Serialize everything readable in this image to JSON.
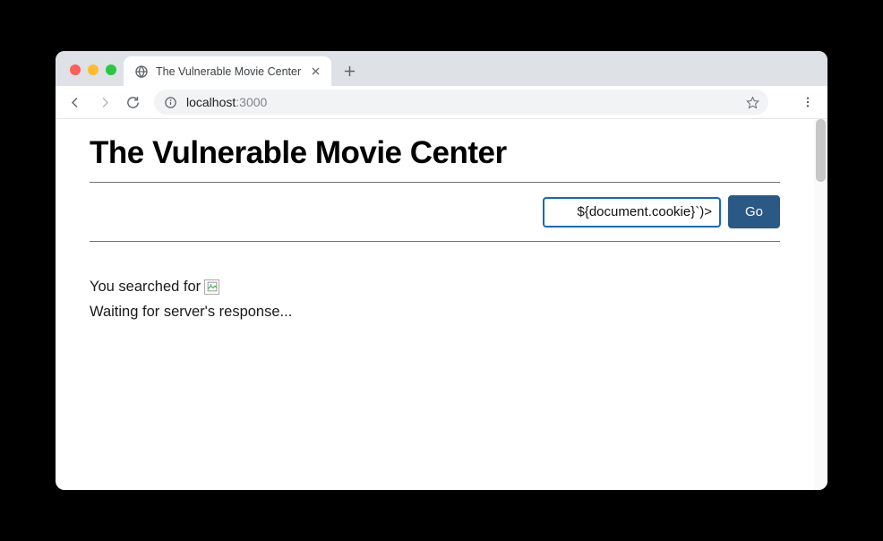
{
  "browser": {
    "tab_title": "The Vulnerable Movie Center",
    "url_host": "localhost",
    "url_port": ":3000"
  },
  "page": {
    "title": "The Vulnerable Movie Center",
    "search": {
      "value": "${document.cookie}`)>",
      "button_label": "Go"
    },
    "results": {
      "searched_for_prefix": "You searched for ",
      "waiting_text": "Waiting for server's response..."
    }
  }
}
